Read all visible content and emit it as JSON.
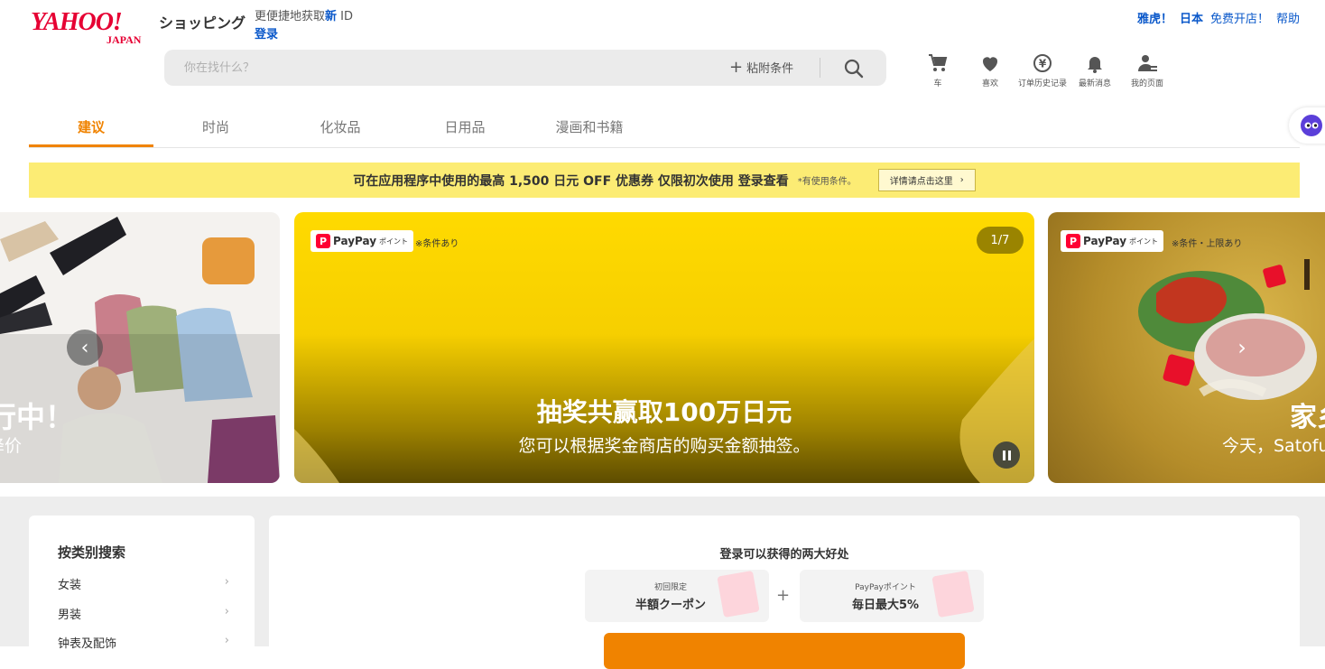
{
  "header": {
    "logo_main": "YAHOO!",
    "logo_sub": "JAPAN",
    "shop_name": "ショッピング",
    "login_hint_prefix": "更便捷地获取",
    "login_hint_new": "新",
    "login_hint_suffix": " ID",
    "login_link": "登录",
    "top_links": {
      "yahoo": "雅虎！",
      "japan": "日本",
      "open_store": "免费开店！",
      "help": "帮助"
    }
  },
  "search": {
    "placeholder": "你在找什么？",
    "attach_label": "粘附条件"
  },
  "icons": {
    "cart": "车",
    "favorites": "喜欢",
    "order_history": "订单历史记录",
    "news": "最新消息",
    "my_page": "我的页面"
  },
  "tabs": [
    "建议",
    "时尚",
    "化妆品",
    "日用品",
    "漫画和书籍"
  ],
  "promo": {
    "text": "可在应用程序中使用的最高 1,500 日元 OFF 优惠券 仅限初次使用 登录查看",
    "note": "*有使用条件。",
    "button": "详情请点击这里"
  },
  "carousel": {
    "left": {
      "big": "行中！",
      "small": "降价"
    },
    "main": {
      "paypay": "PayPay",
      "paypay_small": "ポイント",
      "condition": "※条件あり",
      "counter": "1/7",
      "title": "抽奖共赢取100万日元",
      "subtitle": "您可以根据奖金商店的购买金额抽签。"
    },
    "right": {
      "paypay": "PayPay",
      "paypay_small": "ポイント",
      "condition": "※条件・上限あり",
      "big": "家乡",
      "small": "今天，Satofu"
    }
  },
  "categories": {
    "title": "按类别搜索",
    "items": [
      "女装",
      "男装",
      "钟表及配饰"
    ]
  },
  "benefits": {
    "title": "登录可以获得的两大好处",
    "card1_small": "初回限定",
    "card1_big": "半額クーポン",
    "card2_small": "PayPayポイント",
    "card2_big": "毎日最大5%",
    "plus": "+"
  }
}
